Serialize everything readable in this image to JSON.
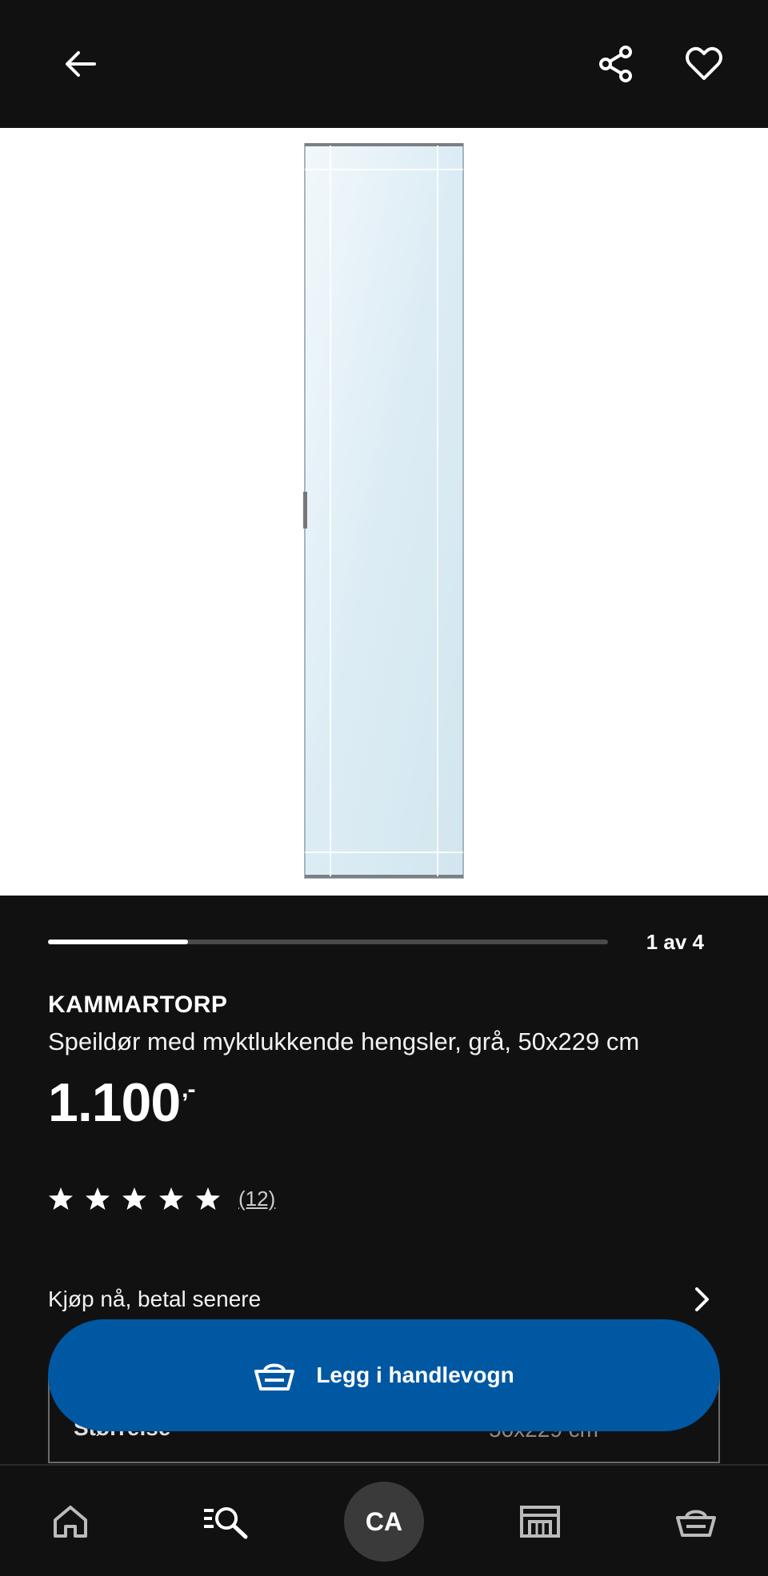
{
  "header": {
    "back_icon": "arrow-left-icon",
    "share_icon": "share-icon",
    "favourite_icon": "heart-icon"
  },
  "carousel": {
    "counter": "1 av 4",
    "current": 1,
    "total": 4
  },
  "product": {
    "name": "KAMMARTORP",
    "description": "Speildør med myktlukkende hengsler, grå, 50x229 cm",
    "price": "1.100",
    "price_suffix": ",-",
    "rating_stars": 5,
    "review_count": "(12)"
  },
  "bnpl": {
    "label": "Kjøp nå, betal senere"
  },
  "size": {
    "label": "Størrelse",
    "value": "50x229 cm"
  },
  "cart_button": {
    "label": "Legg i handlevogn"
  },
  "bottom_nav": {
    "avatar_initials": "CA",
    "items": [
      "home-icon",
      "search-icon",
      "avatar",
      "store-icon",
      "cart-icon"
    ]
  },
  "colors": {
    "background": "#111111",
    "accent_blue": "#0058a3",
    "image_bg": "#ffffff"
  }
}
